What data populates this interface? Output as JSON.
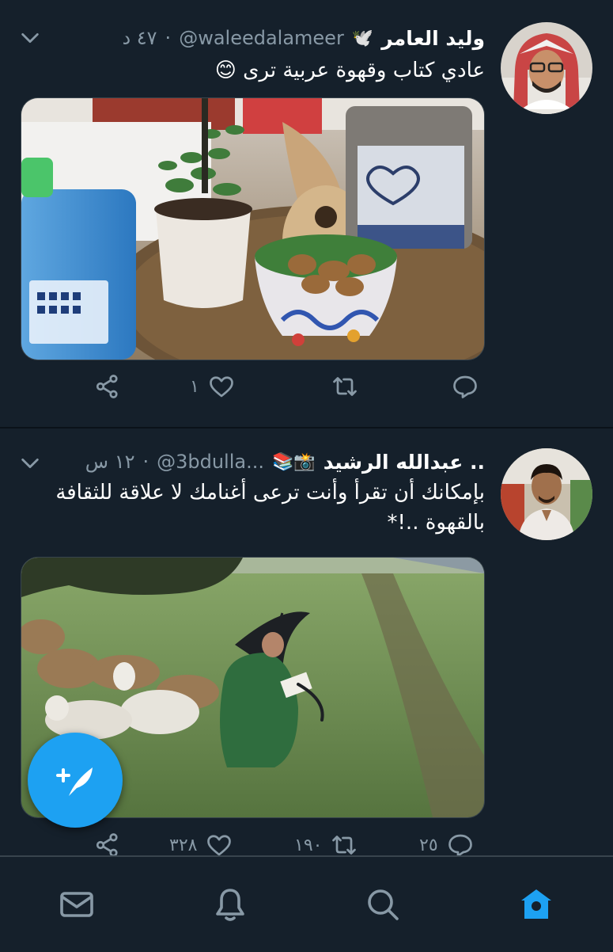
{
  "colors": {
    "background": "#15202b",
    "accent": "#1da1f2",
    "muted": "#8899a6"
  },
  "tweets": [
    {
      "name": "وليد العامر",
      "name_emoji": "🕊️",
      "handle": "@waleedalameer",
      "time": "٤٧ د",
      "text": "عادي كتاب وقهوة عربية ترى 😊",
      "replies": "",
      "retweets": "",
      "likes": "١"
    },
    {
      "name": "عبدالله الرشيد ..",
      "name_emoji": "📚📸",
      "handle": "@3bdulla...",
      "time": "١٢ س",
      "text": "بإمكانك أن تقرأ وأنت ترعى أغنامك لا علاقة للثقافة بالقهوة ..!*",
      "replies": "٢٥",
      "retweets": "١٩٠",
      "likes": "٣٢٨"
    }
  ],
  "separator": "·",
  "icons": {
    "chevron": "chevron-down-icon",
    "reply": "reply-icon",
    "retweet": "retweet-icon",
    "like": "heart-icon",
    "share": "share-icon",
    "compose": "compose-tweet-icon",
    "nav": [
      "mail-icon",
      "bell-icon",
      "search-icon",
      "home-icon"
    ]
  }
}
